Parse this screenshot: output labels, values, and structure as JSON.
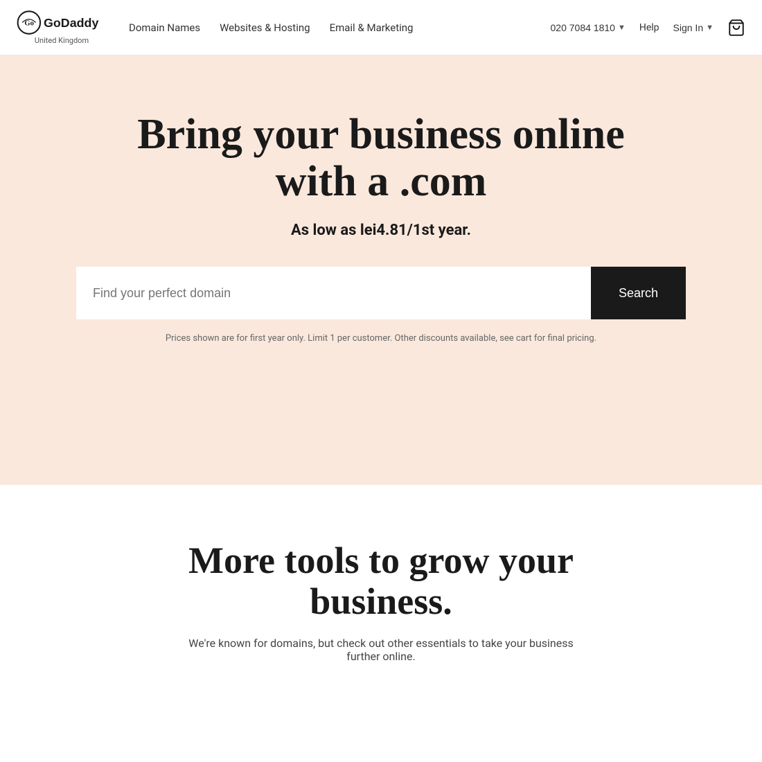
{
  "header": {
    "logo_alt": "GoDaddy",
    "logo_region": "United Kingdom",
    "nav": {
      "items": [
        {
          "label": "Domain Names",
          "href": "#"
        },
        {
          "label": "Websites & Hosting",
          "href": "#"
        },
        {
          "label": "Email & Marketing",
          "href": "#"
        }
      ]
    },
    "phone": "020 7084 1810",
    "help_label": "Help",
    "signin_label": "Sign In"
  },
  "hero": {
    "title": "Bring your business online with a .com",
    "subtitle": "As low as lei4.81/1st year.",
    "search_placeholder": "Find your perfect domain",
    "search_button_label": "Search",
    "disclaimer": "Prices shown are for first year only. Limit 1 per customer. Other discounts available, see cart for final pricing."
  },
  "more_tools": {
    "title": "More tools to grow your business.",
    "subtitle": "We're known for domains, but check out other essentials to take your business further online."
  }
}
